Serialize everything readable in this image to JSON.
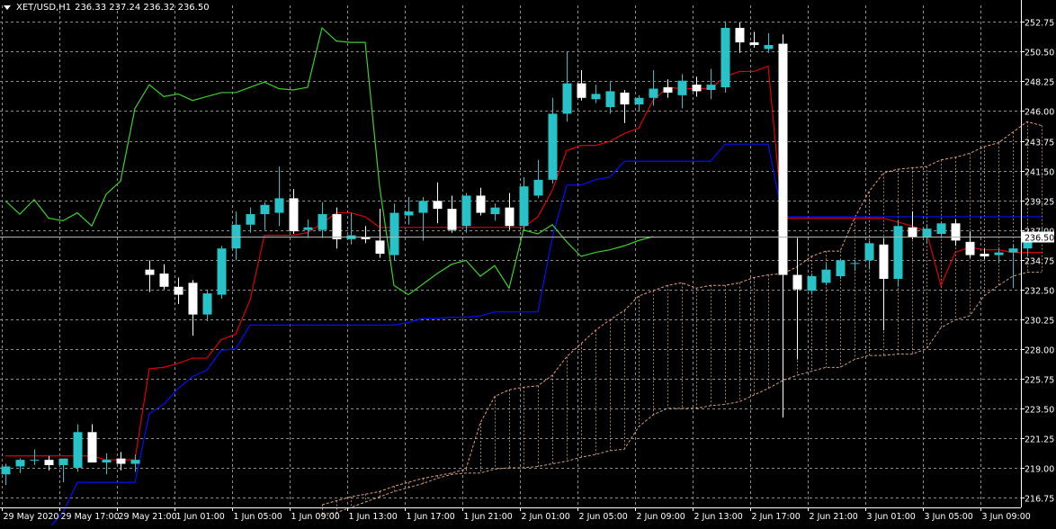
{
  "header": {
    "symbol": "XET/USD,H1",
    "quote": "236.33 237.24 236.32 236.50"
  },
  "colors": {
    "background": "#000000",
    "grid": "#8c8c8c",
    "axis": "#ffffff",
    "bull": "#27c3c8",
    "bear": "#ffffff",
    "tenkan": "#e00000",
    "kijun": "#0010ff",
    "chikou": "#3ecf2b",
    "cloud_a": "#e8a070",
    "cloud_b": "#c8a080",
    "price_line": "#b4b4b4"
  },
  "chart_data": {
    "type": "candlestick",
    "indicator": "Ichimoku",
    "ylim": [
      216.0,
      254.0
    ],
    "y_ticks": [
      "252.75",
      "250.50",
      "248.25",
      "246.00",
      "243.75",
      "241.50",
      "239.25",
      "237.00",
      "234.75",
      "232.50",
      "230.25",
      "228.00",
      "225.75",
      "223.50",
      "221.25",
      "219.00",
      "216.75"
    ],
    "x_ticks": [
      "29 May 2020",
      "29 May 17:00",
      "29 May 21:00",
      "1 Jun 01:00",
      "1 Jun 05:00",
      "1 Jun 09:00",
      "1 Jun 13:00",
      "1 Jun 17:00",
      "1 Jun 21:00",
      "2 Jun 01:00",
      "2 Jun 05:00",
      "2 Jun 09:00",
      "2 Jun 13:00",
      "2 Jun 17:00",
      "2 Jun 21:00",
      "3 Jun 01:00",
      "3 Jun 05:00",
      "3 Jun 09:00"
    ],
    "current_price": "236.50",
    "candles": [
      {
        "o": 218.5,
        "h": 219.3,
        "l": 217.7,
        "c": 219.1
      },
      {
        "o": 219.1,
        "h": 219.7,
        "l": 218.6,
        "c": 219.6
      },
      {
        "o": 219.6,
        "h": 220.4,
        "l": 219.2,
        "c": 219.6
      },
      {
        "o": 219.6,
        "h": 219.9,
        "l": 218.8,
        "c": 219.2
      },
      {
        "o": 219.2,
        "h": 219.6,
        "l": 217.9,
        "c": 219.7
      },
      {
        "o": 219.0,
        "h": 222.3,
        "l": 218.7,
        "c": 221.7
      },
      {
        "o": 221.7,
        "h": 222.3,
        "l": 219.4,
        "c": 219.4
      },
      {
        "o": 219.4,
        "h": 220.1,
        "l": 218.5,
        "c": 219.6
      },
      {
        "o": 219.7,
        "h": 220.2,
        "l": 218.8,
        "c": 219.3
      },
      {
        "o": 219.3,
        "h": 220.0,
        "l": 218.7,
        "c": 219.6
      },
      {
        "o": 234.0,
        "h": 234.7,
        "l": 232.3,
        "c": 233.6
      },
      {
        "o": 233.7,
        "h": 234.4,
        "l": 232.5,
        "c": 232.7
      },
      {
        "o": 232.7,
        "h": 233.4,
        "l": 231.4,
        "c": 232.1
      },
      {
        "o": 233.0,
        "h": 233.2,
        "l": 229.0,
        "c": 230.6
      },
      {
        "o": 230.6,
        "h": 232.5,
        "l": 230.1,
        "c": 232.2
      },
      {
        "o": 232.1,
        "h": 235.8,
        "l": 231.8,
        "c": 235.6
      },
      {
        "o": 235.6,
        "h": 238.4,
        "l": 234.7,
        "c": 237.4
      },
      {
        "o": 237.4,
        "h": 238.7,
        "l": 236.8,
        "c": 238.2
      },
      {
        "o": 238.2,
        "h": 239.1,
        "l": 237.0,
        "c": 238.9
      },
      {
        "o": 238.3,
        "h": 241.8,
        "l": 237.3,
        "c": 239.4
      },
      {
        "o": 239.4,
        "h": 240.1,
        "l": 236.7,
        "c": 236.9
      },
      {
        "o": 237.0,
        "h": 237.8,
        "l": 236.4,
        "c": 237.2
      },
      {
        "o": 237.0,
        "h": 239.1,
        "l": 236.4,
        "c": 238.2
      },
      {
        "o": 238.2,
        "h": 238.7,
        "l": 235.6,
        "c": 236.3
      },
      {
        "o": 236.3,
        "h": 238.3,
        "l": 235.9,
        "c": 236.6
      },
      {
        "o": 236.5,
        "h": 237.3,
        "l": 236.0,
        "c": 236.3
      },
      {
        "o": 236.2,
        "h": 238.6,
        "l": 234.9,
        "c": 235.2
      },
      {
        "o": 235.1,
        "h": 239.0,
        "l": 234.7,
        "c": 238.3
      },
      {
        "o": 238.1,
        "h": 239.5,
        "l": 237.4,
        "c": 238.4
      },
      {
        "o": 238.3,
        "h": 239.5,
        "l": 236.2,
        "c": 239.2
      },
      {
        "o": 239.2,
        "h": 240.6,
        "l": 237.5,
        "c": 238.6
      },
      {
        "o": 238.6,
        "h": 239.6,
        "l": 236.8,
        "c": 237.0
      },
      {
        "o": 237.3,
        "h": 239.8,
        "l": 236.8,
        "c": 239.6
      },
      {
        "o": 239.6,
        "h": 240.2,
        "l": 238.1,
        "c": 238.3
      },
      {
        "o": 238.2,
        "h": 239.0,
        "l": 237.7,
        "c": 238.7
      },
      {
        "o": 238.7,
        "h": 239.8,
        "l": 237.0,
        "c": 237.3
      },
      {
        "o": 237.3,
        "h": 241.0,
        "l": 237.0,
        "c": 240.3
      },
      {
        "o": 239.6,
        "h": 242.3,
        "l": 239.4,
        "c": 240.8
      },
      {
        "o": 240.8,
        "h": 247.0,
        "l": 240.5,
        "c": 245.8
      },
      {
        "o": 245.8,
        "h": 250.5,
        "l": 245.2,
        "c": 248.1
      },
      {
        "o": 248.1,
        "h": 249.1,
        "l": 246.8,
        "c": 247.0
      },
      {
        "o": 246.9,
        "h": 248.0,
        "l": 246.6,
        "c": 247.3
      },
      {
        "o": 246.3,
        "h": 248.2,
        "l": 245.8,
        "c": 247.5
      },
      {
        "o": 247.4,
        "h": 247.6,
        "l": 245.1,
        "c": 246.5
      },
      {
        "o": 246.5,
        "h": 247.2,
        "l": 246.0,
        "c": 247.0
      },
      {
        "o": 247.0,
        "h": 249.1,
        "l": 246.4,
        "c": 247.7
      },
      {
        "o": 247.8,
        "h": 248.4,
        "l": 247.0,
        "c": 247.4
      },
      {
        "o": 247.2,
        "h": 248.8,
        "l": 246.2,
        "c": 248.3
      },
      {
        "o": 248.0,
        "h": 248.6,
        "l": 247.1,
        "c": 247.5
      },
      {
        "o": 247.6,
        "h": 249.2,
        "l": 246.9,
        "c": 248.0
      },
      {
        "o": 247.8,
        "h": 252.8,
        "l": 247.4,
        "c": 252.3
      },
      {
        "o": 252.3,
        "h": 252.7,
        "l": 250.4,
        "c": 251.2
      },
      {
        "o": 251.2,
        "h": 252.0,
        "l": 250.8,
        "c": 251.0
      },
      {
        "o": 250.7,
        "h": 251.9,
        "l": 250.4,
        "c": 251.0
      },
      {
        "o": 251.1,
        "h": 251.8,
        "l": 222.8,
        "c": 233.6
      },
      {
        "o": 233.6,
        "h": 236.4,
        "l": 227.2,
        "c": 232.5
      },
      {
        "o": 232.4,
        "h": 233.7,
        "l": 232.1,
        "c": 233.5
      },
      {
        "o": 233.0,
        "h": 234.5,
        "l": 232.8,
        "c": 234.0
      },
      {
        "o": 233.5,
        "h": 234.8,
        "l": 233.3,
        "c": 234.7
      },
      {
        "o": 234.5,
        "h": 234.7,
        "l": 233.9,
        "c": 234.5
      },
      {
        "o": 234.7,
        "h": 236.2,
        "l": 234.0,
        "c": 236.0
      },
      {
        "o": 235.9,
        "h": 236.4,
        "l": 229.4,
        "c": 233.3
      },
      {
        "o": 233.3,
        "h": 237.7,
        "l": 232.7,
        "c": 237.3
      },
      {
        "o": 237.2,
        "h": 238.4,
        "l": 236.3,
        "c": 236.5
      },
      {
        "o": 236.5,
        "h": 237.4,
        "l": 236.0,
        "c": 237.1
      },
      {
        "o": 236.7,
        "h": 237.6,
        "l": 236.4,
        "c": 237.5
      },
      {
        "o": 237.5,
        "h": 237.8,
        "l": 235.8,
        "c": 236.2
      },
      {
        "o": 236.1,
        "h": 236.9,
        "l": 234.9,
        "c": 235.1
      },
      {
        "o": 235.2,
        "h": 235.6,
        "l": 234.8,
        "c": 235.0
      },
      {
        "o": 235.1,
        "h": 235.6,
        "l": 234.5,
        "c": 235.3
      },
      {
        "o": 235.3,
        "h": 235.9,
        "l": 232.6,
        "c": 235.6
      },
      {
        "o": 235.6,
        "h": 236.3,
        "l": 235.1,
        "c": 236.2
      },
      {
        "o": 236.33,
        "h": 237.24,
        "l": 236.32,
        "c": 236.5
      }
    ],
    "tenkan": [
      219.9,
      219.9,
      219.9,
      219.9,
      219.9,
      219.9,
      219.9,
      219.6,
      219.6,
      219.6,
      226.5,
      226.6,
      226.9,
      227.3,
      227.3,
      228.7,
      229.1,
      231.7,
      236.6,
      236.6,
      236.6,
      236.8,
      237.5,
      238.3,
      238.3,
      238.0,
      237.2,
      237.2,
      237.2,
      237.2,
      237.2,
      237.2,
      237.2,
      237.2,
      237.2,
      237.2,
      237.2,
      238.0,
      240.0,
      243.0,
      243.4,
      243.4,
      243.7,
      244.3,
      244.7,
      246.8,
      247.8,
      247.7,
      247.7,
      247.7,
      248.6,
      249.0,
      249.0,
      249.4,
      237.9,
      237.9,
      237.9,
      237.9,
      237.9,
      237.9,
      237.9,
      237.9,
      237.6,
      237.3,
      236.9,
      232.8,
      235.3,
      235.7,
      235.5,
      235.5,
      235.3,
      235.3,
      235.3
    ],
    "kijun": [
      214.4,
      214.4,
      214.4,
      214.4,
      215.6,
      217.9,
      217.9,
      217.9,
      217.9,
      217.9,
      223.1,
      223.8,
      225.0,
      225.9,
      226.4,
      227.9,
      228.0,
      229.8,
      229.8,
      229.8,
      229.8,
      229.8,
      229.8,
      229.8,
      229.8,
      229.8,
      229.8,
      229.8,
      230.0,
      230.3,
      230.3,
      230.4,
      230.4,
      230.5,
      230.8,
      230.8,
      230.8,
      230.8,
      236.4,
      240.4,
      240.4,
      240.8,
      241.0,
      242.2,
      242.2,
      242.2,
      242.2,
      242.2,
      242.2,
      242.2,
      243.5,
      243.5,
      243.5,
      243.5,
      238.0,
      238.0,
      238.0,
      238.0,
      238.0,
      238.0,
      238.0,
      238.0,
      238.0,
      238.0,
      238.0,
      238.0,
      238.0,
      238.0,
      238.0,
      238.0,
      238.0,
      238.0,
      238.0
    ],
    "chikou": [
      239.2,
      238.2,
      239.3,
      237.9,
      237.7,
      238.3,
      237.3,
      239.7,
      240.7,
      246.2,
      248.0,
      247.1,
      247.3,
      246.8,
      247.1,
      247.4,
      247.4,
      247.8,
      248.2,
      247.7,
      247.6,
      247.8,
      252.3,
      251.3,
      251.2,
      251.2,
      240.3,
      232.8,
      232.1,
      232.9,
      233.7,
      234.4,
      234.7,
      233.5,
      234.3,
      232.6,
      237.0,
      236.7,
      237.4,
      236.1,
      235.0,
      235.3,
      235.5,
      235.8,
      236.2,
      236.5
    ],
    "senkou_a": [
      216.2,
      216.5,
      216.8,
      217.0,
      217.2,
      217.6,
      217.9,
      218.2,
      218.4,
      218.6,
      218.9,
      222.4,
      224.4,
      224.9,
      225.1,
      225.2,
      226.0,
      227.4,
      228.4,
      229.4,
      230.2,
      230.9,
      232.0,
      232.4,
      232.8,
      233.0,
      232.6,
      232.8,
      232.8,
      233.0,
      233.4,
      233.6,
      233.7,
      234.2,
      235.0,
      235.4,
      235.4,
      237.9,
      239.9,
      241.3,
      241.6,
      241.7,
      241.8,
      242.3,
      242.5,
      242.8,
      243.3,
      243.6,
      244.4,
      245.2,
      244.9
    ],
    "senkou_b": [
      215.5,
      215.6,
      216.0,
      216.4,
      216.8,
      217.2,
      217.5,
      217.8,
      218.2,
      218.5,
      218.6,
      218.6,
      218.9,
      219.0,
      219.0,
      219.1,
      219.3,
      219.5,
      219.8,
      220.0,
      220.3,
      220.4,
      222.1,
      223.0,
      223.5,
      223.5,
      223.5,
      223.7,
      223.8,
      224.0,
      224.5,
      225.0,
      225.6,
      226.0,
      226.3,
      226.6,
      226.6,
      227.2,
      227.5,
      227.5,
      227.6,
      227.6,
      228.0,
      229.6,
      230.2,
      230.5,
      232.0,
      232.8,
      233.5,
      233.8,
      233.8
    ]
  }
}
